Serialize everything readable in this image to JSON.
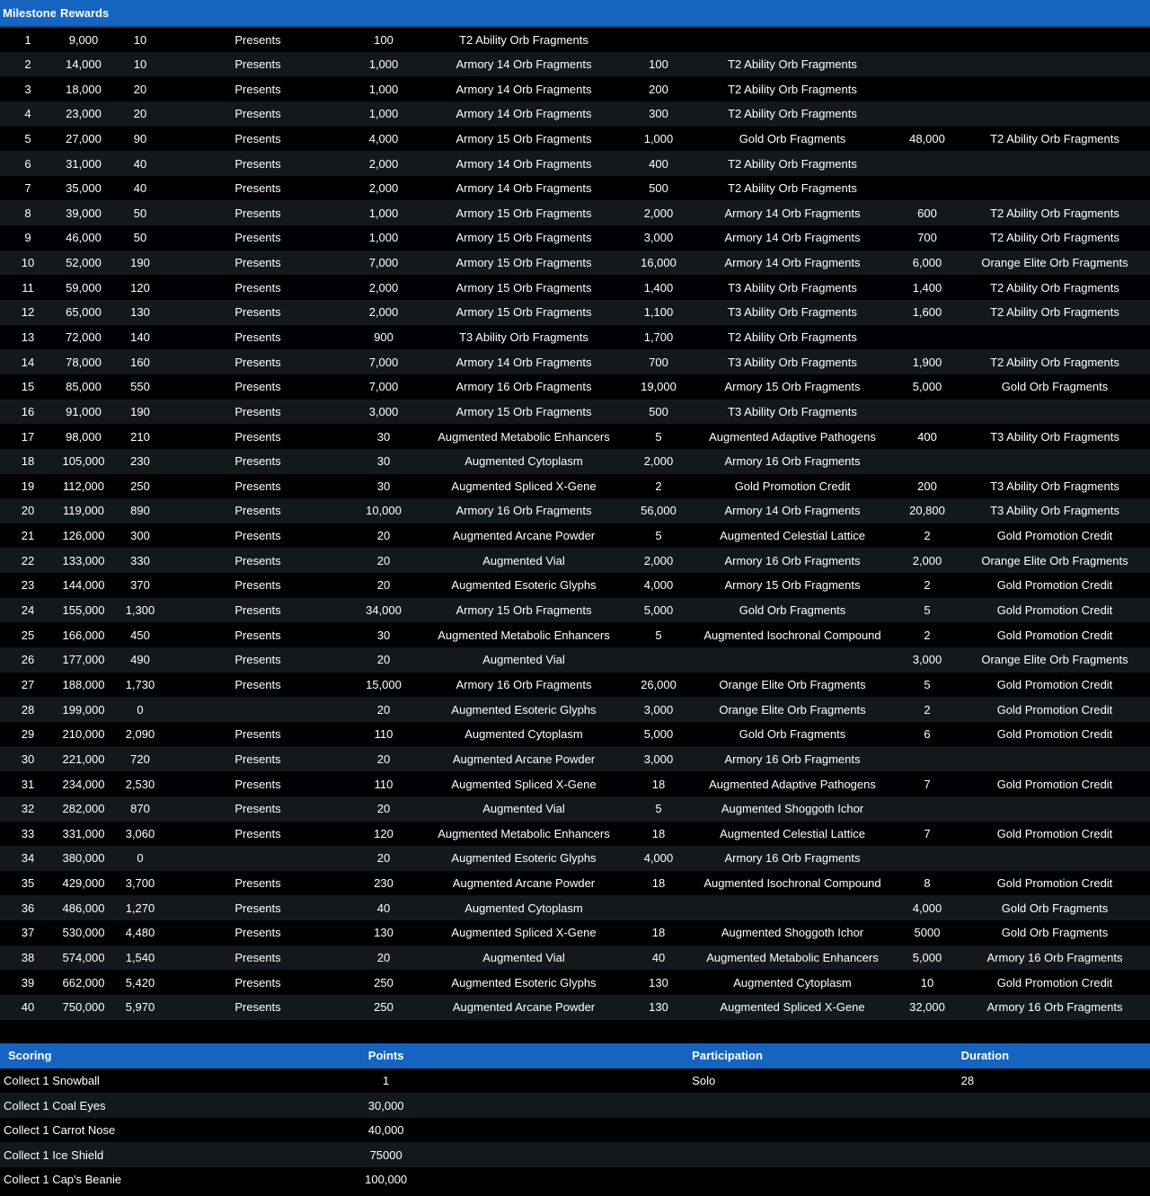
{
  "milestone_table": {
    "header": {
      "milestone": "Milestone",
      "rewards": "Rewards"
    },
    "rows": [
      {
        "num": "1",
        "points": "9,000",
        "presents_count": "10",
        "presents_label": "Presents",
        "r1_qty": "100",
        "r1_item": "T2 Ability Orb Fragments",
        "r2_qty": "",
        "r2_item": "",
        "r3_qty": "",
        "r3_item": ""
      },
      {
        "num": "2",
        "points": "14,000",
        "presents_count": "10",
        "presents_label": "Presents",
        "r1_qty": "1,000",
        "r1_item": "Armory 14 Orb Fragments",
        "r2_qty": "100",
        "r2_item": "T2 Ability Orb Fragments",
        "r3_qty": "",
        "r3_item": ""
      },
      {
        "num": "3",
        "points": "18,000",
        "presents_count": "20",
        "presents_label": "Presents",
        "r1_qty": "1,000",
        "r1_item": "Armory 14 Orb Fragments",
        "r2_qty": "200",
        "r2_item": "T2 Ability Orb Fragments",
        "r3_qty": "",
        "r3_item": ""
      },
      {
        "num": "4",
        "points": "23,000",
        "presents_count": "20",
        "presents_label": "Presents",
        "r1_qty": "1,000",
        "r1_item": "Armory 14 Orb Fragments",
        "r2_qty": "300",
        "r2_item": "T2 Ability Orb Fragments",
        "r3_qty": "",
        "r3_item": ""
      },
      {
        "num": "5",
        "points": "27,000",
        "presents_count": "90",
        "presents_label": "Presents",
        "r1_qty": "4,000",
        "r1_item": "Armory 15 Orb Fragments",
        "r2_qty": "1,000",
        "r2_item": "Gold Orb Fragments",
        "r3_qty": "48,000",
        "r3_item": "T2 Ability Orb Fragments"
      },
      {
        "num": "6",
        "points": "31,000",
        "presents_count": "40",
        "presents_label": "Presents",
        "r1_qty": "2,000",
        "r1_item": "Armory 14 Orb Fragments",
        "r2_qty": "400",
        "r2_item": "T2 Ability Orb Fragments",
        "r3_qty": "",
        "r3_item": ""
      },
      {
        "num": "7",
        "points": "35,000",
        "presents_count": "40",
        "presents_label": "Presents",
        "r1_qty": "2,000",
        "r1_item": "Armory 14 Orb Fragments",
        "r2_qty": "500",
        "r2_item": "T2 Ability Orb Fragments",
        "r3_qty": "",
        "r3_item": ""
      },
      {
        "num": "8",
        "points": "39,000",
        "presents_count": "50",
        "presents_label": "Presents",
        "r1_qty": "1,000",
        "r1_item": "Armory 15 Orb Fragments",
        "r2_qty": "2,000",
        "r2_item": "Armory 14 Orb Fragments",
        "r3_qty": "600",
        "r3_item": "T2 Ability Orb Fragments"
      },
      {
        "num": "9",
        "points": "46,000",
        "presents_count": "50",
        "presents_label": "Presents",
        "r1_qty": "1,000",
        "r1_item": "Armory 15 Orb Fragments",
        "r2_qty": "3,000",
        "r2_item": "Armory 14 Orb Fragments",
        "r3_qty": "700",
        "r3_item": "T2 Ability Orb Fragments"
      },
      {
        "num": "10",
        "points": "52,000",
        "presents_count": "190",
        "presents_label": "Presents",
        "r1_qty": "7,000",
        "r1_item": "Armory 15 Orb Fragments",
        "r2_qty": "16,000",
        "r2_item": "Armory 14 Orb Fragments",
        "r3_qty": "6,000",
        "r3_item": "Orange Elite Orb Fragments"
      },
      {
        "num": "11",
        "points": "59,000",
        "presents_count": "120",
        "presents_label": "Presents",
        "r1_qty": "2,000",
        "r1_item": "Armory 15 Orb Fragments",
        "r2_qty": "1,400",
        "r2_item": "T3 Ability Orb Fragments",
        "r3_qty": "1,400",
        "r3_item": "T2 Ability Orb Fragments"
      },
      {
        "num": "12",
        "points": "65,000",
        "presents_count": "130",
        "presents_label": "Presents",
        "r1_qty": "2,000",
        "r1_item": "Armory 15 Orb Fragments",
        "r2_qty": "1,100",
        "r2_item": "T3 Ability Orb Fragments",
        "r3_qty": "1,600",
        "r3_item": "T2 Ability Orb Fragments"
      },
      {
        "num": "13",
        "points": "72,000",
        "presents_count": "140",
        "presents_label": "Presents",
        "r1_qty": "900",
        "r1_item": "T3 Ability Orb Fragments",
        "r2_qty": "1,700",
        "r2_item": "T2 Ability Orb Fragments",
        "r3_qty": "",
        "r3_item": ""
      },
      {
        "num": "14",
        "points": "78,000",
        "presents_count": "160",
        "presents_label": "Presents",
        "r1_qty": "7,000",
        "r1_item": "Armory 14 Orb Fragments",
        "r2_qty": "700",
        "r2_item": "T3 Ability Orb Fragments",
        "r3_qty": "1,900",
        "r3_item": "T2 Ability Orb Fragments"
      },
      {
        "num": "15",
        "points": "85,000",
        "presents_count": "550",
        "presents_label": "Presents",
        "r1_qty": "7,000",
        "r1_item": "Armory 16 Orb Fragments",
        "r2_qty": "19,000",
        "r2_item": "Armory 15 Orb Fragments",
        "r3_qty": "5,000",
        "r3_item": "Gold Orb Fragments"
      },
      {
        "num": "16",
        "points": "91,000",
        "presents_count": "190",
        "presents_label": "Presents",
        "r1_qty": "3,000",
        "r1_item": "Armory 15 Orb Fragments",
        "r2_qty": "500",
        "r2_item": "T3 Ability Orb Fragments",
        "r3_qty": "",
        "r3_item": ""
      },
      {
        "num": "17",
        "points": "98,000",
        "presents_count": "210",
        "presents_label": "Presents",
        "r1_qty": "30",
        "r1_item": "Augmented Metabolic Enhancers",
        "r2_qty": "5",
        "r2_item": "Augmented Adaptive Pathogens",
        "r3_qty": "400",
        "r3_item": "T3 Ability Orb Fragments"
      },
      {
        "num": "18",
        "points": "105,000",
        "presents_count": "230",
        "presents_label": "Presents",
        "r1_qty": "30",
        "r1_item": "Augmented Cytoplasm",
        "r2_qty": "2,000",
        "r2_item": "Armory 16 Orb Fragments",
        "r3_qty": "",
        "r3_item": ""
      },
      {
        "num": "19",
        "points": "112,000",
        "presents_count": "250",
        "presents_label": "Presents",
        "r1_qty": "30",
        "r1_item": "Augmented Spliced X-Gene",
        "r2_qty": "2",
        "r2_item": "Gold Promotion Credit",
        "r3_qty": "200",
        "r3_item": "T3 Ability Orb Fragments"
      },
      {
        "num": "20",
        "points": "119,000",
        "presents_count": "890",
        "presents_label": "Presents",
        "r1_qty": "10,000",
        "r1_item": "Armory 16 Orb Fragments",
        "r2_qty": "56,000",
        "r2_item": "Armory 14 Orb Fragments",
        "r3_qty": "20,800",
        "r3_item": "T3 Ability Orb Fragments"
      },
      {
        "num": "21",
        "points": "126,000",
        "presents_count": "300",
        "presents_label": "Presents",
        "r1_qty": "20",
        "r1_item": "Augmented Arcane Powder",
        "r2_qty": "5",
        "r2_item": "Augmented Celestial Lattice",
        "r3_qty": "2",
        "r3_item": "Gold Promotion Credit"
      },
      {
        "num": "22",
        "points": "133,000",
        "presents_count": "330",
        "presents_label": "Presents",
        "r1_qty": "20",
        "r1_item": "Augmented Vial",
        "r2_qty": "2,000",
        "r2_item": "Armory 16 Orb Fragments",
        "r3_qty": "2,000",
        "r3_item": "Orange Elite Orb Fragments"
      },
      {
        "num": "23",
        "points": "144,000",
        "presents_count": "370",
        "presents_label": "Presents",
        "r1_qty": "20",
        "r1_item": "Augmented Esoteric Glyphs",
        "r2_qty": "4,000",
        "r2_item": "Armory 15 Orb Fragments",
        "r3_qty": "2",
        "r3_item": "Gold Promotion Credit"
      },
      {
        "num": "24",
        "points": "155,000",
        "presents_count": "1,300",
        "presents_label": "Presents",
        "r1_qty": "34,000",
        "r1_item": "Armory 15 Orb Fragments",
        "r2_qty": "5,000",
        "r2_item": "Gold Orb Fragments",
        "r3_qty": "5",
        "r3_item": "Gold Promotion Credit"
      },
      {
        "num": "25",
        "points": "166,000",
        "presents_count": "450",
        "presents_label": "Presents",
        "r1_qty": "30",
        "r1_item": "Augmented Metabolic Enhancers",
        "r2_qty": "5",
        "r2_item": "Augmented Isochronal Compound",
        "r3_qty": "2",
        "r3_item": "Gold Promotion Credit"
      },
      {
        "num": "26",
        "points": "177,000",
        "presents_count": "490",
        "presents_label": "Presents",
        "r1_qty": "20",
        "r1_item": "Augmented Vial",
        "r2_qty": "",
        "r2_item": "",
        "r3_qty": "3,000",
        "r3_item": "Orange Elite Orb Fragments"
      },
      {
        "num": "27",
        "points": "188,000",
        "presents_count": "1,730",
        "presents_label": "Presents",
        "r1_qty": "15,000",
        "r1_item": "Armory 16 Orb Fragments",
        "r2_qty": "26,000",
        "r2_item": "Orange Elite Orb Fragments",
        "r3_qty": "5",
        "r3_item": "Gold Promotion Credit"
      },
      {
        "num": "28",
        "points": "199,000",
        "presents_count": "0",
        "presents_label": "",
        "r1_qty": "20",
        "r1_item": "Augmented Esoteric Glyphs",
        "r2_qty": "3,000",
        "r2_item": "Orange Elite Orb Fragments",
        "r3_qty": "2",
        "r3_item": "Gold Promotion Credit"
      },
      {
        "num": "29",
        "points": "210,000",
        "presents_count": "2,090",
        "presents_label": "Presents",
        "r1_qty": "110",
        "r1_item": "Augmented Cytoplasm",
        "r2_qty": "5,000",
        "r2_item": "Gold Orb Fragments",
        "r3_qty": "6",
        "r3_item": "Gold Promotion Credit"
      },
      {
        "num": "30",
        "points": "221,000",
        "presents_count": "720",
        "presents_label": "Presents",
        "r1_qty": "20",
        "r1_item": "Augmented Arcane Powder",
        "r2_qty": "3,000",
        "r2_item": "Armory 16 Orb Fragments",
        "r3_qty": "",
        "r3_item": ""
      },
      {
        "num": "31",
        "points": "234,000",
        "presents_count": "2,530",
        "presents_label": "Presents",
        "r1_qty": "110",
        "r1_item": "Augmented Spliced X-Gene",
        "r2_qty": "18",
        "r2_item": "Augmented Adaptive Pathogens",
        "r3_qty": "7",
        "r3_item": "Gold Promotion Credit"
      },
      {
        "num": "32",
        "points": "282,000",
        "presents_count": "870",
        "presents_label": "Presents",
        "r1_qty": "20",
        "r1_item": "Augmented Vial",
        "r2_qty": "5",
        "r2_item": "Augmented Shoggoth Ichor",
        "r3_qty": "",
        "r3_item": ""
      },
      {
        "num": "33",
        "points": "331,000",
        "presents_count": "3,060",
        "presents_label": "Presents",
        "r1_qty": "120",
        "r1_item": "Augmented Metabolic Enhancers",
        "r2_qty": "18",
        "r2_item": "Augmented Celestial Lattice",
        "r3_qty": "7",
        "r3_item": "Gold Promotion Credit"
      },
      {
        "num": "34",
        "points": "380,000",
        "presents_count": "0",
        "presents_label": "",
        "r1_qty": "20",
        "r1_item": "Augmented Esoteric Glyphs",
        "r2_qty": "4,000",
        "r2_item": "Armory 16 Orb Fragments",
        "r3_qty": "",
        "r3_item": ""
      },
      {
        "num": "35",
        "points": "429,000",
        "presents_count": "3,700",
        "presents_label": "Presents",
        "r1_qty": "230",
        "r1_item": "Augmented Arcane Powder",
        "r2_qty": "18",
        "r2_item": "Augmented Isochronal Compound",
        "r3_qty": "8",
        "r3_item": "Gold Promotion Credit"
      },
      {
        "num": "36",
        "points": "486,000",
        "presents_count": "1,270",
        "presents_label": "Presents",
        "r1_qty": "40",
        "r1_item": "Augmented Cytoplasm",
        "r2_qty": "",
        "r2_item": "",
        "r3_qty": "4,000",
        "r3_item": "Gold Orb Fragments"
      },
      {
        "num": "37",
        "points": "530,000",
        "presents_count": "4,480",
        "presents_label": "Presents",
        "r1_qty": "130",
        "r1_item": "Augmented Spliced X-Gene",
        "r2_qty": "18",
        "r2_item": "Augmented Shoggoth Ichor",
        "r3_qty": "5000",
        "r3_item": "Gold Orb Fragments"
      },
      {
        "num": "38",
        "points": "574,000",
        "presents_count": "1,540",
        "presents_label": "Presents",
        "r1_qty": "20",
        "r1_item": "Augmented Vial",
        "r2_qty": "40",
        "r2_item": "Augmented Metabolic Enhancers",
        "r3_qty": "5,000",
        "r3_item": "Armory 16 Orb Fragments"
      },
      {
        "num": "39",
        "points": "662,000",
        "presents_count": "5,420",
        "presents_label": "Presents",
        "r1_qty": "250",
        "r1_item": "Augmented Esoteric Glyphs",
        "r2_qty": "130",
        "r2_item": "Augmented Cytoplasm",
        "r3_qty": "10",
        "r3_item": "Gold Promotion Credit"
      },
      {
        "num": "40",
        "points": "750,000",
        "presents_count": "5,970",
        "presents_label": "Presents",
        "r1_qty": "250",
        "r1_item": "Augmented Arcane Powder",
        "r2_qty": "130",
        "r2_item": "Augmented Spliced X-Gene",
        "r3_qty": "32,000",
        "r3_item": "Armory 16 Orb Fragments"
      }
    ]
  },
  "scoring_table": {
    "header": {
      "scoring": "Scoring",
      "points": "Points",
      "participation": "Participation",
      "duration": "Duration"
    },
    "rows": [
      {
        "name": "Collect 1 Snowball",
        "points": "1",
        "participation": "Solo",
        "duration": "28"
      },
      {
        "name": "Collect 1 Coal Eyes",
        "points": "30,000",
        "participation": "",
        "duration": ""
      },
      {
        "name": "Collect 1 Carrot Nose",
        "points": "40,000",
        "participation": "",
        "duration": ""
      },
      {
        "name": "Collect 1 Ice Shield",
        "points": "75000",
        "participation": "",
        "duration": ""
      },
      {
        "name": "Collect 1 Cap's Beanie",
        "points": "100,000",
        "participation": "",
        "duration": ""
      }
    ]
  },
  "colors": {
    "header_bg": "#1565c0",
    "row_odd": "#000000",
    "row_even": "#13181c",
    "text": "#ffffff"
  }
}
